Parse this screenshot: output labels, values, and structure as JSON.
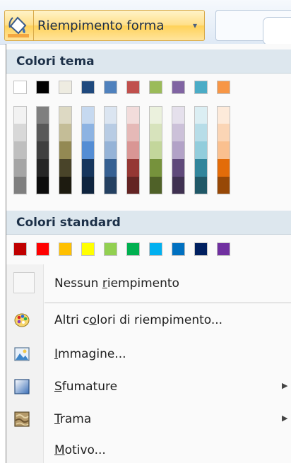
{
  "ribbon": {
    "button_label": "Riempimento forma",
    "button_arrow": "▾"
  },
  "palette": {
    "theme_header": "Colori tema",
    "standard_header": "Colori standard",
    "theme_colors": [
      "#FFFFFF",
      "#000000",
      "#EEECE1",
      "#1F497D",
      "#4F81BD",
      "#C0504D",
      "#9BBB59",
      "#8064A2",
      "#4BACC6",
      "#F79646"
    ],
    "theme_shades": [
      [
        "#F2F2F2",
        "#D8D8D8",
        "#BFBFBF",
        "#A5A5A5",
        "#7F7F7F"
      ],
      [
        "#7F7F7F",
        "#595959",
        "#3F3F3F",
        "#262626",
        "#0C0C0C"
      ],
      [
        "#DDD9C3",
        "#C4BD97",
        "#938953",
        "#494429",
        "#1D1B10"
      ],
      [
        "#C6D9F0",
        "#8DB3E2",
        "#548DD4",
        "#17365D",
        "#0F243E"
      ],
      [
        "#DBE5F1",
        "#B8CCE4",
        "#95B3D7",
        "#366092",
        "#244061"
      ],
      [
        "#F2DCDB",
        "#E5B9B7",
        "#D99694",
        "#953734",
        "#632423"
      ],
      [
        "#EBF1DD",
        "#D7E3BC",
        "#C3D69B",
        "#76923C",
        "#4F6128"
      ],
      [
        "#E5E0EC",
        "#CCC1D9",
        "#B2A2C7",
        "#5F497A",
        "#3F3151"
      ],
      [
        "#DBEEF3",
        "#B7DDE8",
        "#92CDDC",
        "#31859B",
        "#205867"
      ],
      [
        "#FDEADA",
        "#FBD5B5",
        "#FAC08F",
        "#E36C09",
        "#974806"
      ]
    ],
    "standard_colors": [
      "#C00000",
      "#FF0000",
      "#FFC000",
      "#FFFF00",
      "#92D050",
      "#00B050",
      "#00B0F0",
      "#0070C0",
      "#002060",
      "#7030A0"
    ]
  },
  "menu": {
    "no_fill": {
      "pre": "Nessun ",
      "key": "r",
      "post": "iempimento"
    },
    "more_colors": {
      "pre": "Altri c",
      "key": "o",
      "post": "lori di riempimento..."
    },
    "picture": {
      "pre": "",
      "key": "I",
      "post": "mmagine..."
    },
    "gradient": {
      "pre": "",
      "key": "S",
      "post": "fumature",
      "arrow": "▶"
    },
    "texture": {
      "pre": "",
      "key": "T",
      "post": "rama",
      "arrow": "▶"
    },
    "pattern": {
      "pre": "",
      "key": "M",
      "post": "otivo..."
    }
  },
  "icons": {
    "fill_bucket": "paint-bucket-icon",
    "more_colors": "color-palette-icon",
    "picture": "picture-icon",
    "gradient": "gradient-icon",
    "texture": "texture-icon"
  }
}
